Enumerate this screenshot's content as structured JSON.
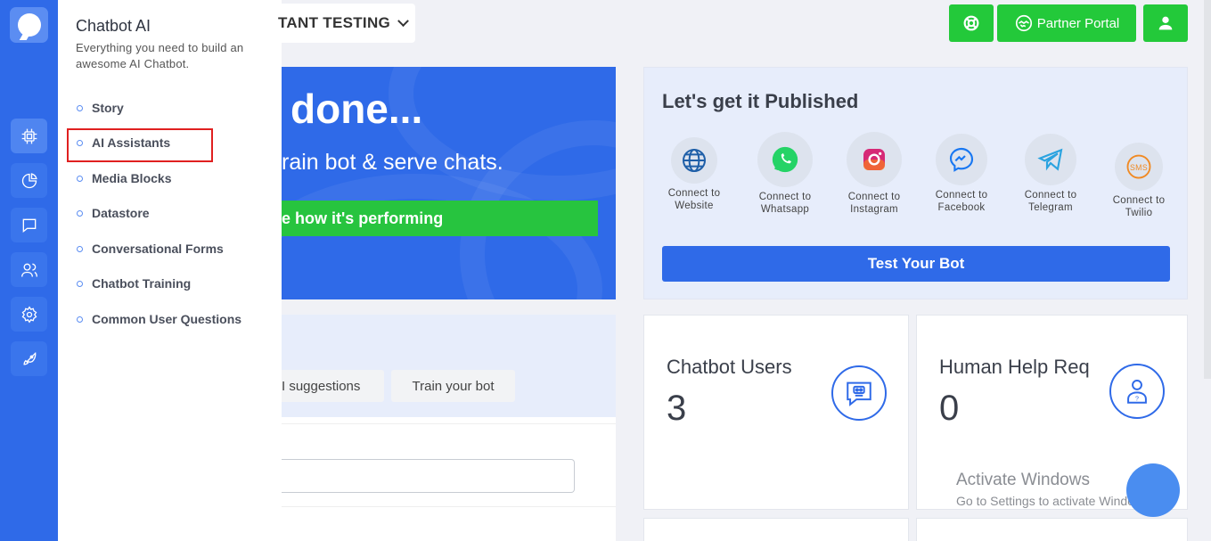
{
  "sidebar": {
    "icons": [
      "chatbot-logo-icon",
      "chip-icon",
      "pie-chart-icon",
      "chat-icon",
      "users-icon",
      "gear-icon",
      "rocket-icon"
    ]
  },
  "flyout": {
    "title": "Chatbot AI",
    "subtitle": "Everything you need to build an awesome AI Chatbot.",
    "items": [
      {
        "label": "Story"
      },
      {
        "label": "AI Assistants",
        "highlighted": true
      },
      {
        "label": "Media Blocks"
      },
      {
        "label": "Datastore"
      },
      {
        "label": "Conversational Forms"
      },
      {
        "label": "Chatbot Training"
      },
      {
        "label": "Common User Questions"
      }
    ]
  },
  "header": {
    "assistant_selector": "TANT TESTING",
    "partner_portal_label": "Partner Portal",
    "colors": {
      "green": "#23c93a",
      "blue": "#2f6ae8"
    }
  },
  "hero": {
    "title": "done...",
    "subtitle": "rain bot & serve chats.",
    "button_label": "e how it's performing"
  },
  "publish": {
    "title": "Let's get it Published",
    "channels": [
      {
        "label": "Connect to Website",
        "icon": "globe-icon"
      },
      {
        "label": "Connect to Whatsapp",
        "icon": "whatsapp-icon"
      },
      {
        "label": "Connect to Instagram",
        "icon": "instagram-icon"
      },
      {
        "label": "Connect to Facebook",
        "icon": "messenger-icon"
      },
      {
        "label": "Connect to Telegram",
        "icon": "telegram-icon"
      },
      {
        "label": "Connect to Twilio",
        "icon": "sms-icon"
      }
    ],
    "test_button_label": "Test Your Bot"
  },
  "suggest": {
    "ai_suggestions_label": "I suggestions",
    "train_label": "Train your bot"
  },
  "stats": [
    {
      "title": "Chatbot Users",
      "value": "3"
    },
    {
      "title": "Human Help Req",
      "value": "0"
    }
  ],
  "watermark": {
    "line1": "Activate Windows",
    "line2": "Go to Settings to activate Windows."
  }
}
